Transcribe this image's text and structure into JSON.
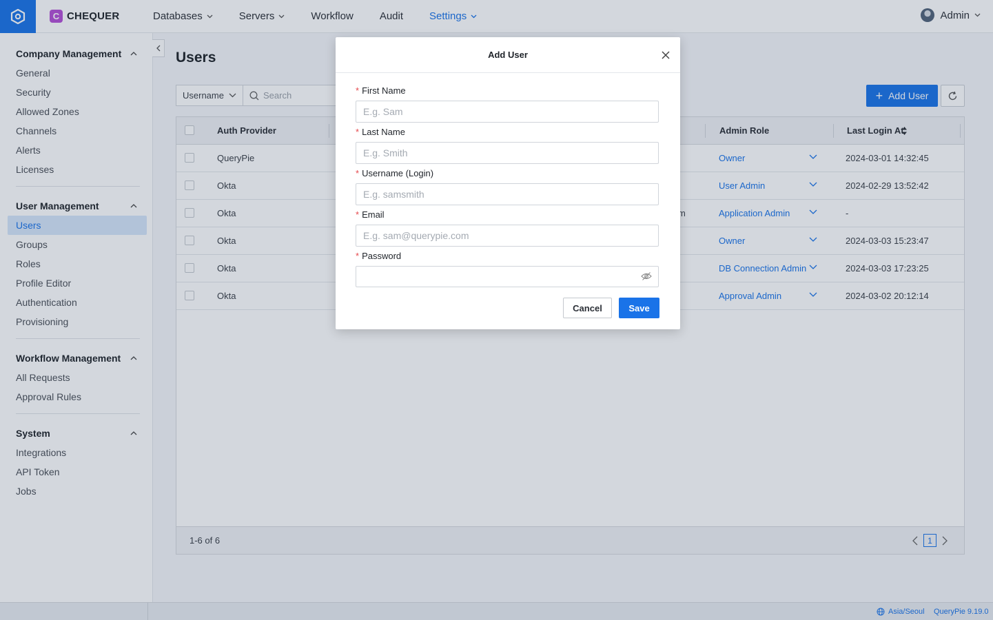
{
  "brand": {
    "name": "CHEQUER",
    "badge": "C"
  },
  "nav": [
    {
      "label": "Databases",
      "has_menu": true
    },
    {
      "label": "Servers",
      "has_menu": true
    },
    {
      "label": "Workflow",
      "has_menu": false
    },
    {
      "label": "Audit",
      "has_menu": false
    },
    {
      "label": "Settings",
      "has_menu": true,
      "active": true
    }
  ],
  "user": {
    "name": "Admin"
  },
  "sidebar": {
    "sections": [
      {
        "title": "Company Management",
        "items": [
          "General",
          "Security",
          "Allowed Zones",
          "Channels",
          "Alerts",
          "Licenses"
        ]
      },
      {
        "title": "User Management",
        "items": [
          "Users",
          "Groups",
          "Roles",
          "Profile Editor",
          "Authentication",
          "Provisioning"
        ],
        "active_item": "Users"
      },
      {
        "title": "Workflow Management",
        "items": [
          "All Requests",
          "Approval Rules"
        ]
      },
      {
        "title": "System",
        "items": [
          "Integrations",
          "API Token",
          "Jobs"
        ]
      }
    ]
  },
  "page": {
    "title": "Users",
    "filter_field": "Username",
    "search_placeholder": "Search",
    "add_user_label": "Add User"
  },
  "table": {
    "columns": {
      "auth_provider": "Auth Provider",
      "admin_role": "Admin Role",
      "last_login": "Last Login At"
    },
    "rows": [
      {
        "auth_provider": "QueryPie",
        "partial": "",
        "admin_role": "Owner",
        "last_login": "2024-03-01 14:32:45"
      },
      {
        "auth_provider": "Okta",
        "partial": "",
        "admin_role": "User Admin",
        "last_login": "2024-02-29 13:52:42"
      },
      {
        "auth_provider": "Okta",
        "partial": "m",
        "admin_role": "Application Admin",
        "last_login": "-"
      },
      {
        "auth_provider": "Okta",
        "partial": "",
        "admin_role": "Owner",
        "last_login": "2024-03-03 15:23:47"
      },
      {
        "auth_provider": "Okta",
        "partial": "",
        "admin_role": "DB Connection Admin",
        "last_login": "2024-03-03 17:23:25"
      },
      {
        "auth_provider": "Okta",
        "partial": "",
        "admin_role": "Approval Admin",
        "last_login": "2024-03-02 20:12:14"
      }
    ],
    "footer": {
      "count": "1-6 of 6",
      "page": "1"
    }
  },
  "status": {
    "timezone": "Asia/Seoul",
    "version": "QueryPie 9.19.0"
  },
  "modal": {
    "title": "Add User",
    "fields": [
      {
        "label": "First Name",
        "placeholder": "E.g. Sam",
        "value": ""
      },
      {
        "label": "Last Name",
        "placeholder": "E.g. Smith",
        "value": ""
      },
      {
        "label": "Username (Login)",
        "placeholder": "E.g. samsmith",
        "value": ""
      },
      {
        "label": "Email",
        "placeholder": "E.g. sam@querypie.com",
        "value": ""
      },
      {
        "label": "Password",
        "placeholder": "",
        "value": ""
      }
    ],
    "required_mark": "*",
    "cancel_label": "Cancel",
    "save_label": "Save"
  },
  "colors": {
    "accent": "#1a73e8",
    "brand_badge": "#b54fd6",
    "required": "#e5484d"
  }
}
